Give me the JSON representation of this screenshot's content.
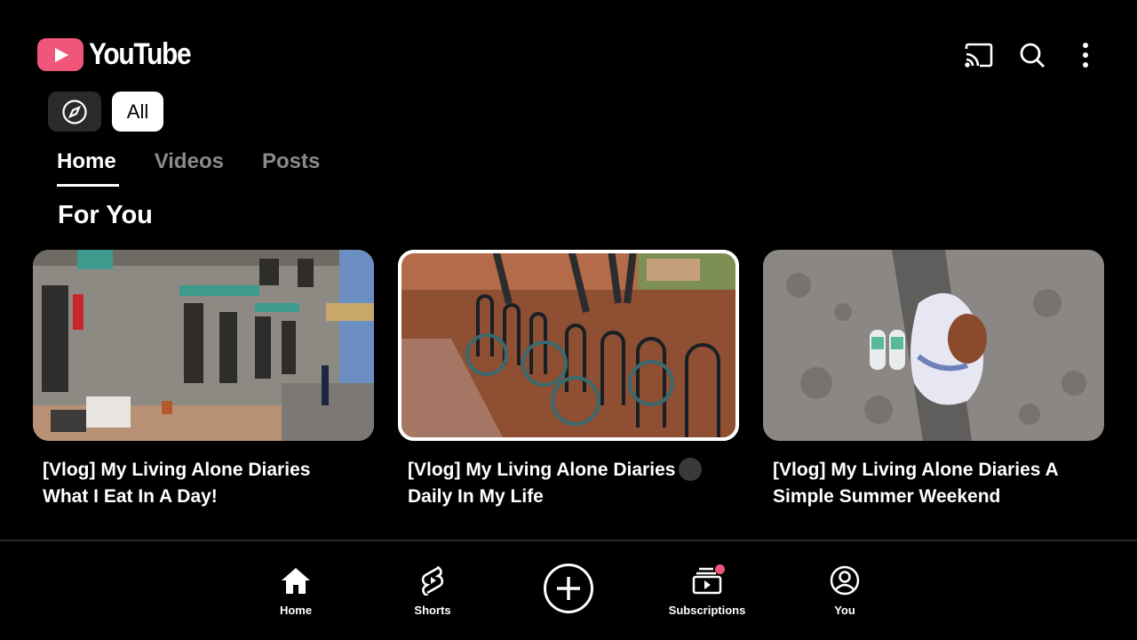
{
  "app": {
    "logo_text": "YouTube",
    "brand_color": "#f0567a"
  },
  "top_actions": [
    {
      "icon": "cast-icon"
    },
    {
      "icon": "search-icon"
    },
    {
      "icon": "more-vert-icon"
    }
  ],
  "chips": {
    "explore_icon": "compass-icon",
    "all_label": "All"
  },
  "tabs": [
    {
      "label": "Home",
      "active": true
    },
    {
      "label": "Videos",
      "active": false
    },
    {
      "label": "Posts",
      "active": false
    }
  ],
  "section": {
    "title": "For You"
  },
  "videos": [
    {
      "title": "[Vlog] My Living Alone Diaries What I Eat In A Day!",
      "selected": false
    },
    {
      "title": "[Vlog] My Living Alone Diaries A Daily In My Life",
      "selected": true
    },
    {
      "title": "[Vlog] My Living Alone Diaries A Simple Summer Weekend",
      "selected": false
    }
  ],
  "bottom_nav": {
    "home": "Home",
    "shorts": "Shorts",
    "create_icon": "plus-circle-icon",
    "subscriptions": "Subscriptions",
    "you": "You"
  }
}
